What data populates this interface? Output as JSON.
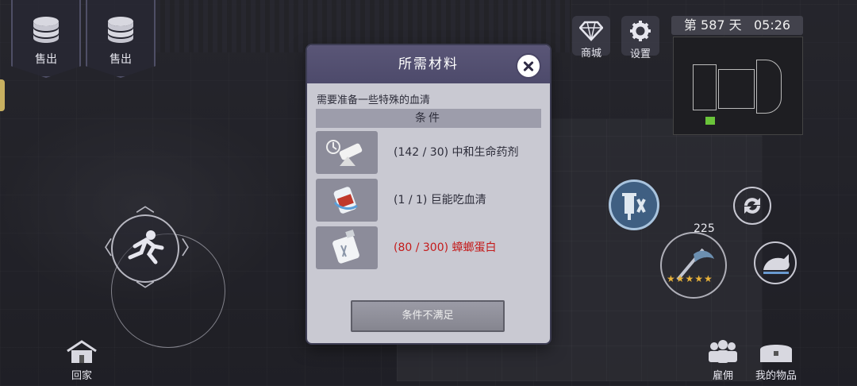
{
  "top_left": {
    "sell_buttons": [
      {
        "label": "售出",
        "icon": "coin-stack-icon"
      },
      {
        "label": "售出",
        "icon": "coin-stack-icon"
      }
    ]
  },
  "top_right": {
    "shop_label": "商城",
    "settings_label": "设置",
    "day_prefix": "第",
    "day_number": "587",
    "day_suffix": "天",
    "time": "05:26"
  },
  "hud": {
    "ammo_count": "225",
    "weapon_stars": 5,
    "stars_text": "★★★★★",
    "home_label": "回家",
    "hire_label": "雇佣",
    "items_label": "我的物品"
  },
  "dialog": {
    "title": "所需材料",
    "description": "需要准备一些特殊的血清",
    "condition_header": "条件",
    "requirements": [
      {
        "have": 142,
        "need": 30,
        "text": "(142 / 30) 中和生命药剂",
        "met": true,
        "icon": "neutralizer-potion-icon"
      },
      {
        "have": 1,
        "need": 1,
        "text": "(1 / 1) 巨能吃血清",
        "met": true,
        "icon": "serum-vial-icon"
      },
      {
        "have": 80,
        "need": 300,
        "text": "(80 / 300) 蟑螂蛋白",
        "met": false,
        "icon": "protein-bottle-icon"
      }
    ],
    "action_button_label": "条件不满足"
  },
  "colors": {
    "dialog_header": "#4d4a6b",
    "unmet_text": "#c41a1a",
    "star": "#e8b23a"
  }
}
